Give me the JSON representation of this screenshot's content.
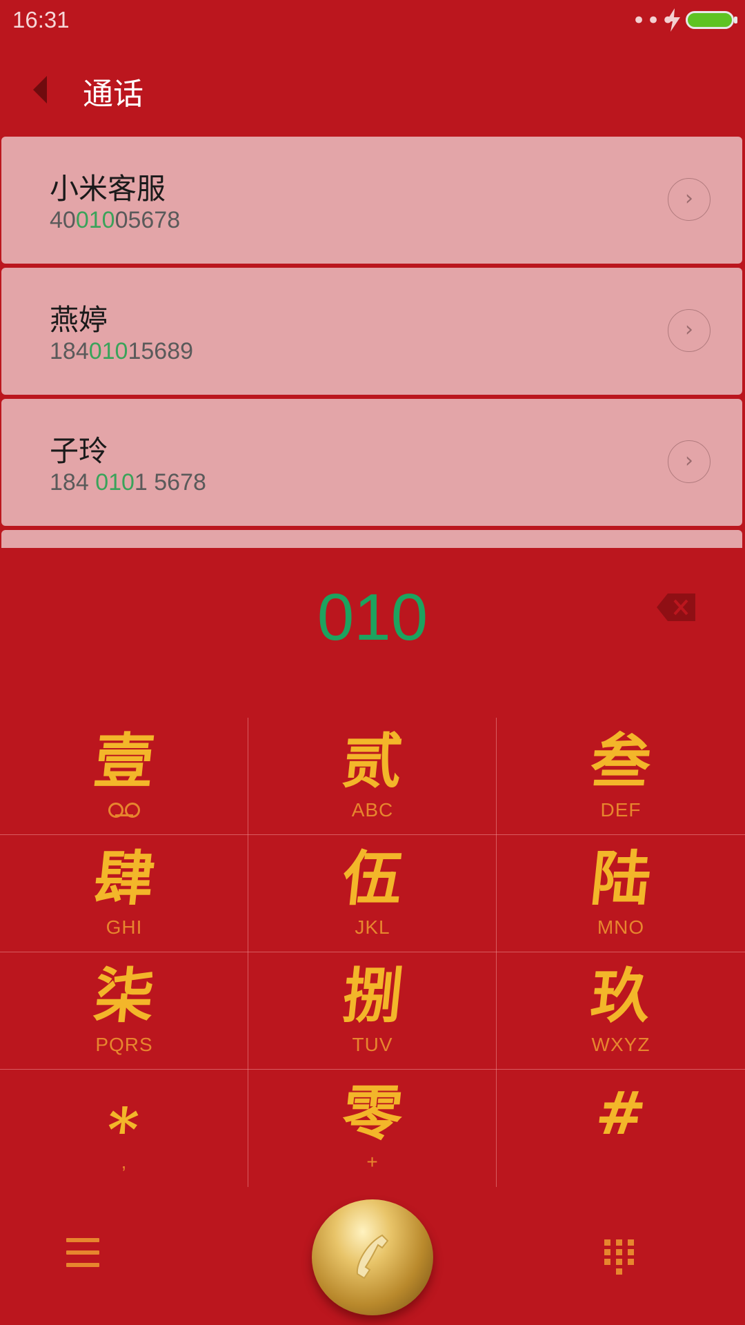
{
  "status_bar": {
    "time": "16:31",
    "more": "•••"
  },
  "header": {
    "title": "通话"
  },
  "contacts": [
    {
      "name": "小米客服",
      "phone_pre": "40",
      "phone_match": "010",
      "phone_post": "05678"
    },
    {
      "name": "燕婷",
      "phone_pre": "184",
      "phone_match": "010",
      "phone_post": "15689"
    },
    {
      "name": "子玲",
      "phone_pre": "184 ",
      "phone_match": "010",
      "phone_post": "1 5678"
    }
  ],
  "dialed_number": "010",
  "keypad": [
    {
      "glyph": "壹",
      "sub": "",
      "icon": "voicemail-icon"
    },
    {
      "glyph": "贰",
      "sub": "ABC"
    },
    {
      "glyph": "叁",
      "sub": "DEF"
    },
    {
      "glyph": "肆",
      "sub": "GHI"
    },
    {
      "glyph": "伍",
      "sub": "JKL"
    },
    {
      "glyph": "陆",
      "sub": "MNO"
    },
    {
      "glyph": "柒",
      "sub": "PQRS"
    },
    {
      "glyph": "捌",
      "sub": "TUV"
    },
    {
      "glyph": "玖",
      "sub": "WXYZ"
    },
    {
      "glyph": "⁎",
      "sub": ","
    },
    {
      "glyph": "零",
      "sub": "+"
    },
    {
      "glyph": "#",
      "sub": ""
    }
  ],
  "colors": {
    "background": "#bb161e",
    "card": "#e3a5a8",
    "match": "#3aa35a",
    "dialed": "#1da35f",
    "key_glyph": "#f3b62a",
    "key_sub": "#e7862e"
  }
}
